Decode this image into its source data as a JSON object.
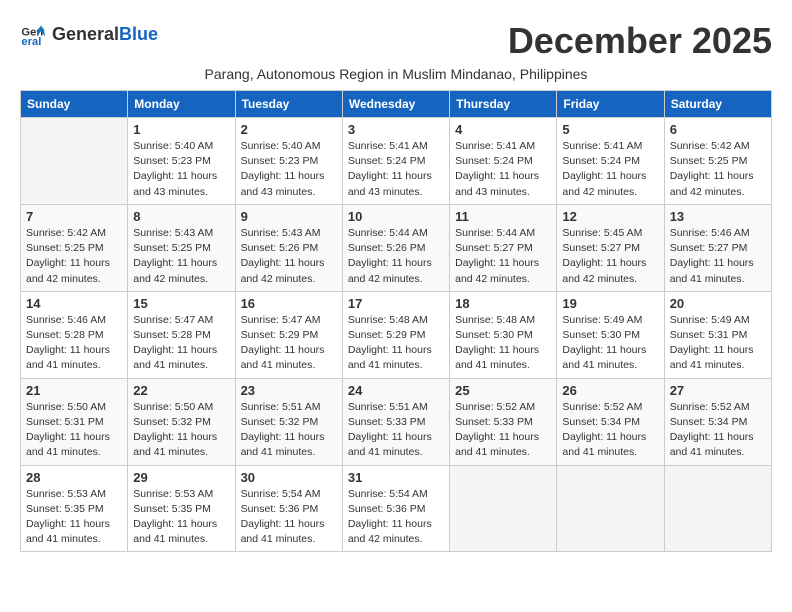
{
  "logo": {
    "general": "General",
    "blue": "Blue"
  },
  "title": "December 2025",
  "subtitle": "Parang, Autonomous Region in Muslim Mindanao, Philippines",
  "headers": [
    "Sunday",
    "Monday",
    "Tuesday",
    "Wednesday",
    "Thursday",
    "Friday",
    "Saturday"
  ],
  "weeks": [
    [
      {
        "day": "",
        "info": ""
      },
      {
        "day": "1",
        "info": "Sunrise: 5:40 AM\nSunset: 5:23 PM\nDaylight: 11 hours\nand 43 minutes."
      },
      {
        "day": "2",
        "info": "Sunrise: 5:40 AM\nSunset: 5:23 PM\nDaylight: 11 hours\nand 43 minutes."
      },
      {
        "day": "3",
        "info": "Sunrise: 5:41 AM\nSunset: 5:24 PM\nDaylight: 11 hours\nand 43 minutes."
      },
      {
        "day": "4",
        "info": "Sunrise: 5:41 AM\nSunset: 5:24 PM\nDaylight: 11 hours\nand 43 minutes."
      },
      {
        "day": "5",
        "info": "Sunrise: 5:41 AM\nSunset: 5:24 PM\nDaylight: 11 hours\nand 42 minutes."
      },
      {
        "day": "6",
        "info": "Sunrise: 5:42 AM\nSunset: 5:25 PM\nDaylight: 11 hours\nand 42 minutes."
      }
    ],
    [
      {
        "day": "7",
        "info": "Sunrise: 5:42 AM\nSunset: 5:25 PM\nDaylight: 11 hours\nand 42 minutes."
      },
      {
        "day": "8",
        "info": "Sunrise: 5:43 AM\nSunset: 5:25 PM\nDaylight: 11 hours\nand 42 minutes."
      },
      {
        "day": "9",
        "info": "Sunrise: 5:43 AM\nSunset: 5:26 PM\nDaylight: 11 hours\nand 42 minutes."
      },
      {
        "day": "10",
        "info": "Sunrise: 5:44 AM\nSunset: 5:26 PM\nDaylight: 11 hours\nand 42 minutes."
      },
      {
        "day": "11",
        "info": "Sunrise: 5:44 AM\nSunset: 5:27 PM\nDaylight: 11 hours\nand 42 minutes."
      },
      {
        "day": "12",
        "info": "Sunrise: 5:45 AM\nSunset: 5:27 PM\nDaylight: 11 hours\nand 42 minutes."
      },
      {
        "day": "13",
        "info": "Sunrise: 5:46 AM\nSunset: 5:27 PM\nDaylight: 11 hours\nand 41 minutes."
      }
    ],
    [
      {
        "day": "14",
        "info": "Sunrise: 5:46 AM\nSunset: 5:28 PM\nDaylight: 11 hours\nand 41 minutes."
      },
      {
        "day": "15",
        "info": "Sunrise: 5:47 AM\nSunset: 5:28 PM\nDaylight: 11 hours\nand 41 minutes."
      },
      {
        "day": "16",
        "info": "Sunrise: 5:47 AM\nSunset: 5:29 PM\nDaylight: 11 hours\nand 41 minutes."
      },
      {
        "day": "17",
        "info": "Sunrise: 5:48 AM\nSunset: 5:29 PM\nDaylight: 11 hours\nand 41 minutes."
      },
      {
        "day": "18",
        "info": "Sunrise: 5:48 AM\nSunset: 5:30 PM\nDaylight: 11 hours\nand 41 minutes."
      },
      {
        "day": "19",
        "info": "Sunrise: 5:49 AM\nSunset: 5:30 PM\nDaylight: 11 hours\nand 41 minutes."
      },
      {
        "day": "20",
        "info": "Sunrise: 5:49 AM\nSunset: 5:31 PM\nDaylight: 11 hours\nand 41 minutes."
      }
    ],
    [
      {
        "day": "21",
        "info": "Sunrise: 5:50 AM\nSunset: 5:31 PM\nDaylight: 11 hours\nand 41 minutes."
      },
      {
        "day": "22",
        "info": "Sunrise: 5:50 AM\nSunset: 5:32 PM\nDaylight: 11 hours\nand 41 minutes."
      },
      {
        "day": "23",
        "info": "Sunrise: 5:51 AM\nSunset: 5:32 PM\nDaylight: 11 hours\nand 41 minutes."
      },
      {
        "day": "24",
        "info": "Sunrise: 5:51 AM\nSunset: 5:33 PM\nDaylight: 11 hours\nand 41 minutes."
      },
      {
        "day": "25",
        "info": "Sunrise: 5:52 AM\nSunset: 5:33 PM\nDaylight: 11 hours\nand 41 minutes."
      },
      {
        "day": "26",
        "info": "Sunrise: 5:52 AM\nSunset: 5:34 PM\nDaylight: 11 hours\nand 41 minutes."
      },
      {
        "day": "27",
        "info": "Sunrise: 5:52 AM\nSunset: 5:34 PM\nDaylight: 11 hours\nand 41 minutes."
      }
    ],
    [
      {
        "day": "28",
        "info": "Sunrise: 5:53 AM\nSunset: 5:35 PM\nDaylight: 11 hours\nand 41 minutes."
      },
      {
        "day": "29",
        "info": "Sunrise: 5:53 AM\nSunset: 5:35 PM\nDaylight: 11 hours\nand 41 minutes."
      },
      {
        "day": "30",
        "info": "Sunrise: 5:54 AM\nSunset: 5:36 PM\nDaylight: 11 hours\nand 41 minutes."
      },
      {
        "day": "31",
        "info": "Sunrise: 5:54 AM\nSunset: 5:36 PM\nDaylight: 11 hours\nand 42 minutes."
      },
      {
        "day": "",
        "info": ""
      },
      {
        "day": "",
        "info": ""
      },
      {
        "day": "",
        "info": ""
      }
    ]
  ]
}
